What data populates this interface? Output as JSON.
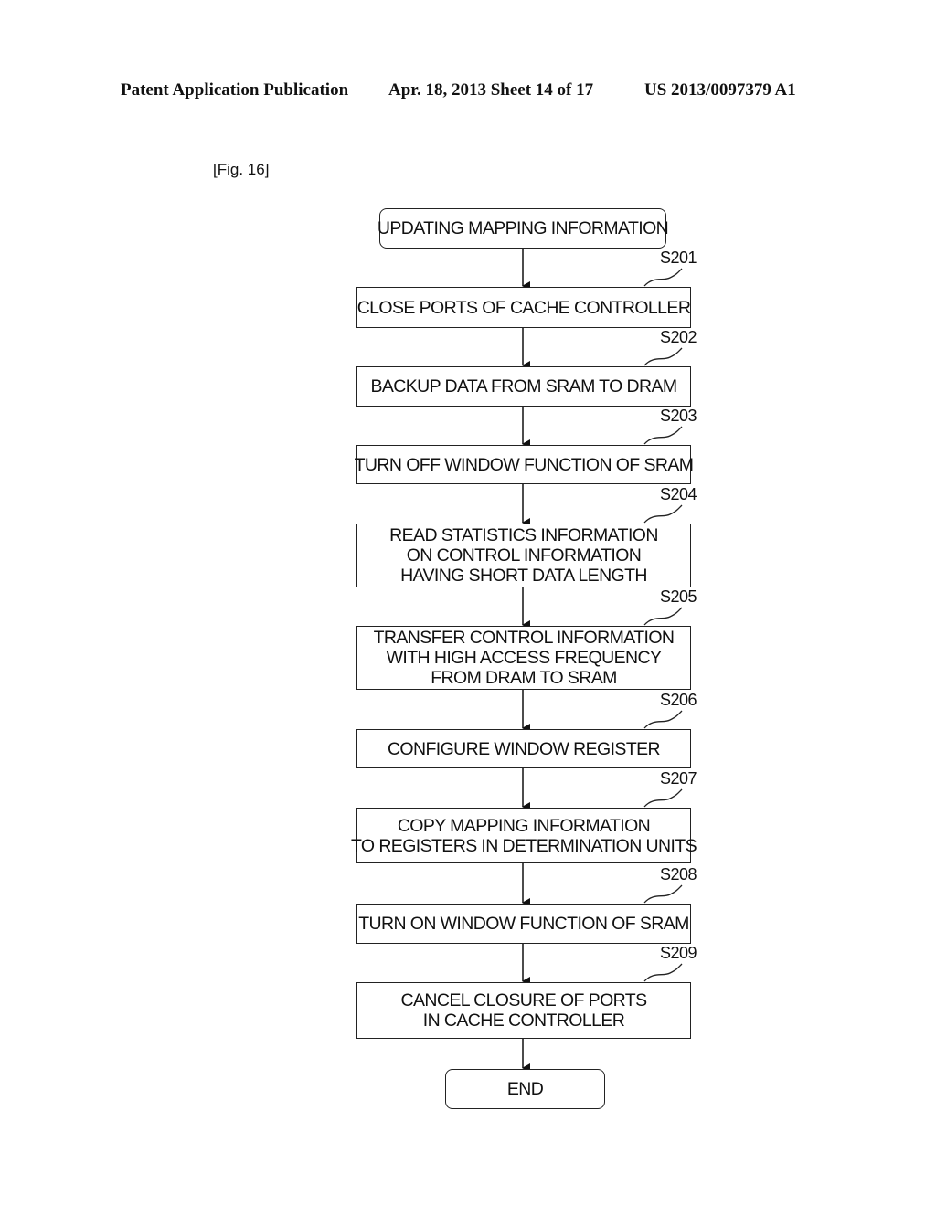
{
  "header": {
    "left": "Patent Application Publication",
    "middle": "Apr. 18, 2013  Sheet 14 of 17",
    "right": "US 2013/0097379 A1"
  },
  "figure_label": "[Fig. 16]",
  "flowchart": {
    "start": "UPDATING MAPPING INFORMATION",
    "steps": [
      {
        "id": "S201",
        "lines": [
          "CLOSE PORTS OF CACHE CONTROLLER"
        ]
      },
      {
        "id": "S202",
        "lines": [
          "BACKUP DATA FROM SRAM TO DRAM"
        ]
      },
      {
        "id": "S203",
        "lines": [
          "TURN OFF WINDOW FUNCTION OF SRAM"
        ]
      },
      {
        "id": "S204",
        "lines": [
          "READ STATISTICS INFORMATION",
          "ON CONTROL INFORMATION",
          "HAVING SHORT DATA LENGTH"
        ]
      },
      {
        "id": "S205",
        "lines": [
          "TRANSFER CONTROL INFORMATION",
          "WITH HIGH ACCESS FREQUENCY",
          "FROM DRAM TO SRAM"
        ]
      },
      {
        "id": "S206",
        "lines": [
          "CONFIGURE WINDOW REGISTER"
        ]
      },
      {
        "id": "S207",
        "lines": [
          "COPY MAPPING INFORMATION",
          "TO REGISTERS IN DETERMINATION UNITS"
        ]
      },
      {
        "id": "S208",
        "lines": [
          "TURN ON WINDOW FUNCTION OF SRAM"
        ]
      },
      {
        "id": "S209",
        "lines": [
          "CANCEL CLOSURE OF PORTS",
          "IN CACHE CONTROLLER"
        ]
      }
    ],
    "end": "END"
  }
}
